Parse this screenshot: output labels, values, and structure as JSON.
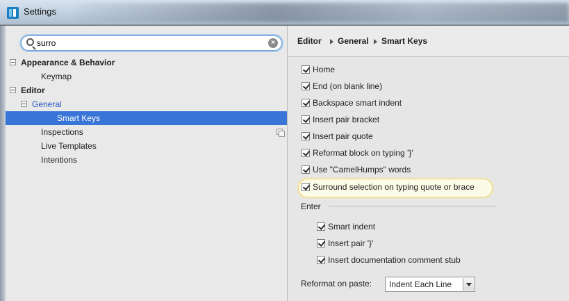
{
  "window": {
    "title": "Settings"
  },
  "search": {
    "value": "surro"
  },
  "tree": {
    "appearance": "Appearance & Behavior",
    "keymap": "Keymap",
    "editor": "Editor",
    "general": "General",
    "smart_keys": "Smart Keys",
    "inspections": "Inspections",
    "live_templates": "Live Templates",
    "intentions": "Intentions"
  },
  "breadcrumb": [
    "Editor",
    "General",
    "Smart Keys"
  ],
  "options": [
    {
      "label": "Home",
      "checked": true
    },
    {
      "label": "End (on blank line)",
      "checked": true
    },
    {
      "label": "Backspace smart indent",
      "checked": true
    },
    {
      "label": "Insert pair bracket",
      "checked": true
    },
    {
      "label": "Insert pair quote",
      "checked": true
    },
    {
      "label": "Reformat block on typing '}'",
      "checked": true
    },
    {
      "label": "Use \"CamelHumps\" words",
      "checked": true
    },
    {
      "label": "Surround selection on typing quote or brace",
      "checked": true
    }
  ],
  "enter": {
    "label": "Enter",
    "options": [
      {
        "label": "Smart indent",
        "checked": true
      },
      {
        "label": "Insert pair '}'",
        "checked": true
      },
      {
        "label": "Insert documentation comment stub",
        "checked": true
      }
    ]
  },
  "reformat_on_paste": {
    "label": "Reformat on paste:",
    "value": "Indent Each Line"
  },
  "colors": {
    "selection": "#3875d7",
    "link": "#2455c8",
    "highlight_border": "#f0d66a"
  }
}
